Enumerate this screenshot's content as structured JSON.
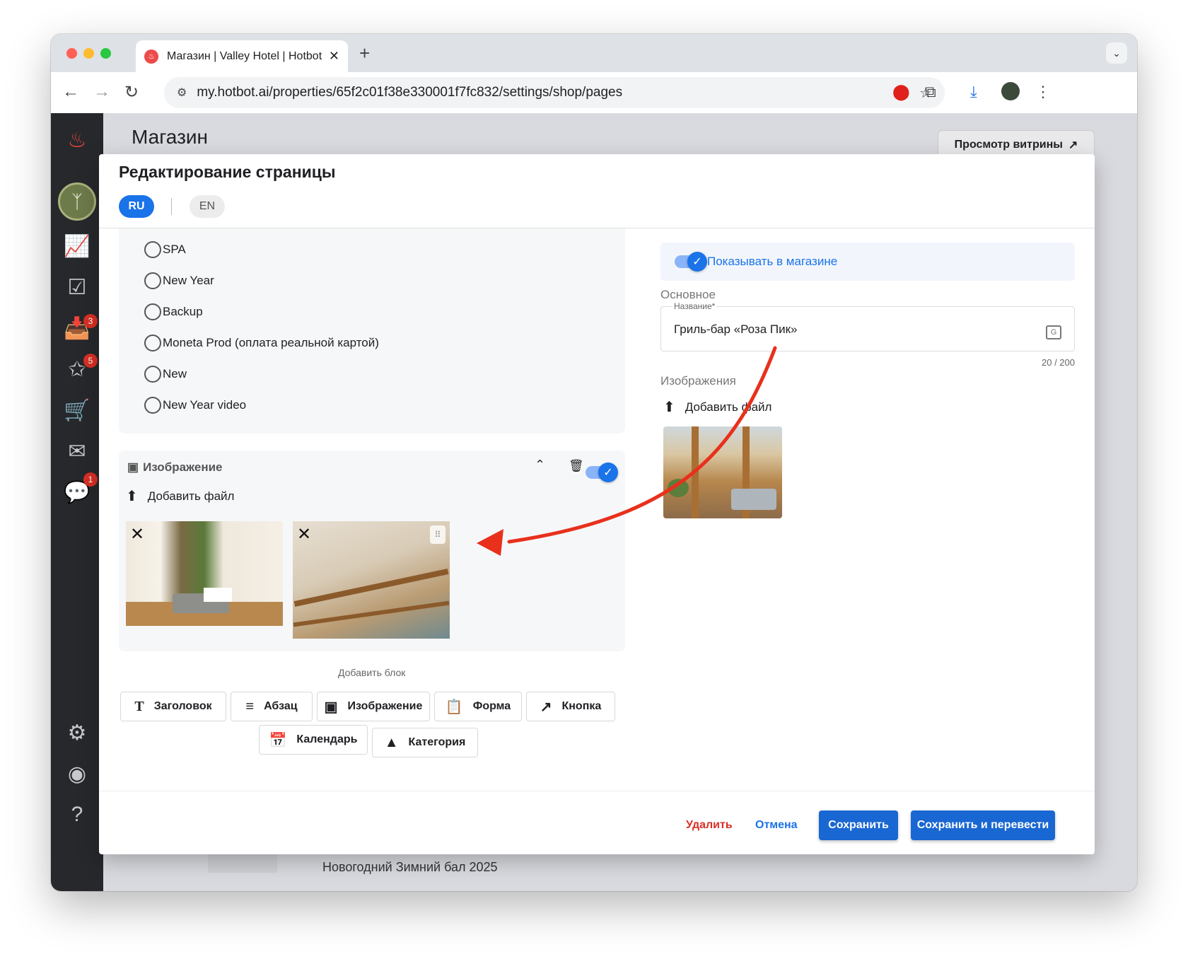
{
  "browser": {
    "tab_title": "Магазин | Valley Hotel | Hotbot",
    "url": "my.hotbot.ai/properties/65f2c01f38e330001f7fc832/settings/shop/pages"
  },
  "sidebar": {
    "badges": {
      "inbox": "3",
      "reviews": "5",
      "chat": "1"
    }
  },
  "page": {
    "title": "Магазин",
    "storefront_button": "Просмотр витрины",
    "background_row_text": "Новогодний Зимний бал 2025"
  },
  "modal": {
    "title": "Редактирование страницы",
    "lang_ru": "RU",
    "lang_en": "EN",
    "radio_options": [
      "SPA",
      "New Year",
      "Backup",
      "Moneta Prod (оплата реальной картой)",
      "New",
      "New Year video"
    ],
    "image_block": {
      "title": "Изображение",
      "add_file": "Добавить файл"
    },
    "add_block": {
      "label": "Добавить блок",
      "buttons": [
        "Заголовок",
        "Абзац",
        "Изображение",
        "Форма",
        "Кнопка",
        "Календарь",
        "Категория"
      ]
    },
    "right": {
      "show_in_shop": "Показывать в магазине",
      "section_main": "Основное",
      "name_label": "Название*",
      "name_value": "Гриль-бар «Роза Пик»",
      "counter": "20 / 200",
      "section_images": "Изображения",
      "add_file": "Добавить файл"
    },
    "footer": {
      "delete": "Удалить",
      "cancel": "Отмена",
      "save": "Сохранить",
      "save_translate": "Сохранить и перевести"
    }
  },
  "colors": {
    "accent": "#1a73e8",
    "primary_button": "#1967d2",
    "danger": "#d93025",
    "annotation_arrow": "#e8301c",
    "sidebar": "#26282c"
  }
}
